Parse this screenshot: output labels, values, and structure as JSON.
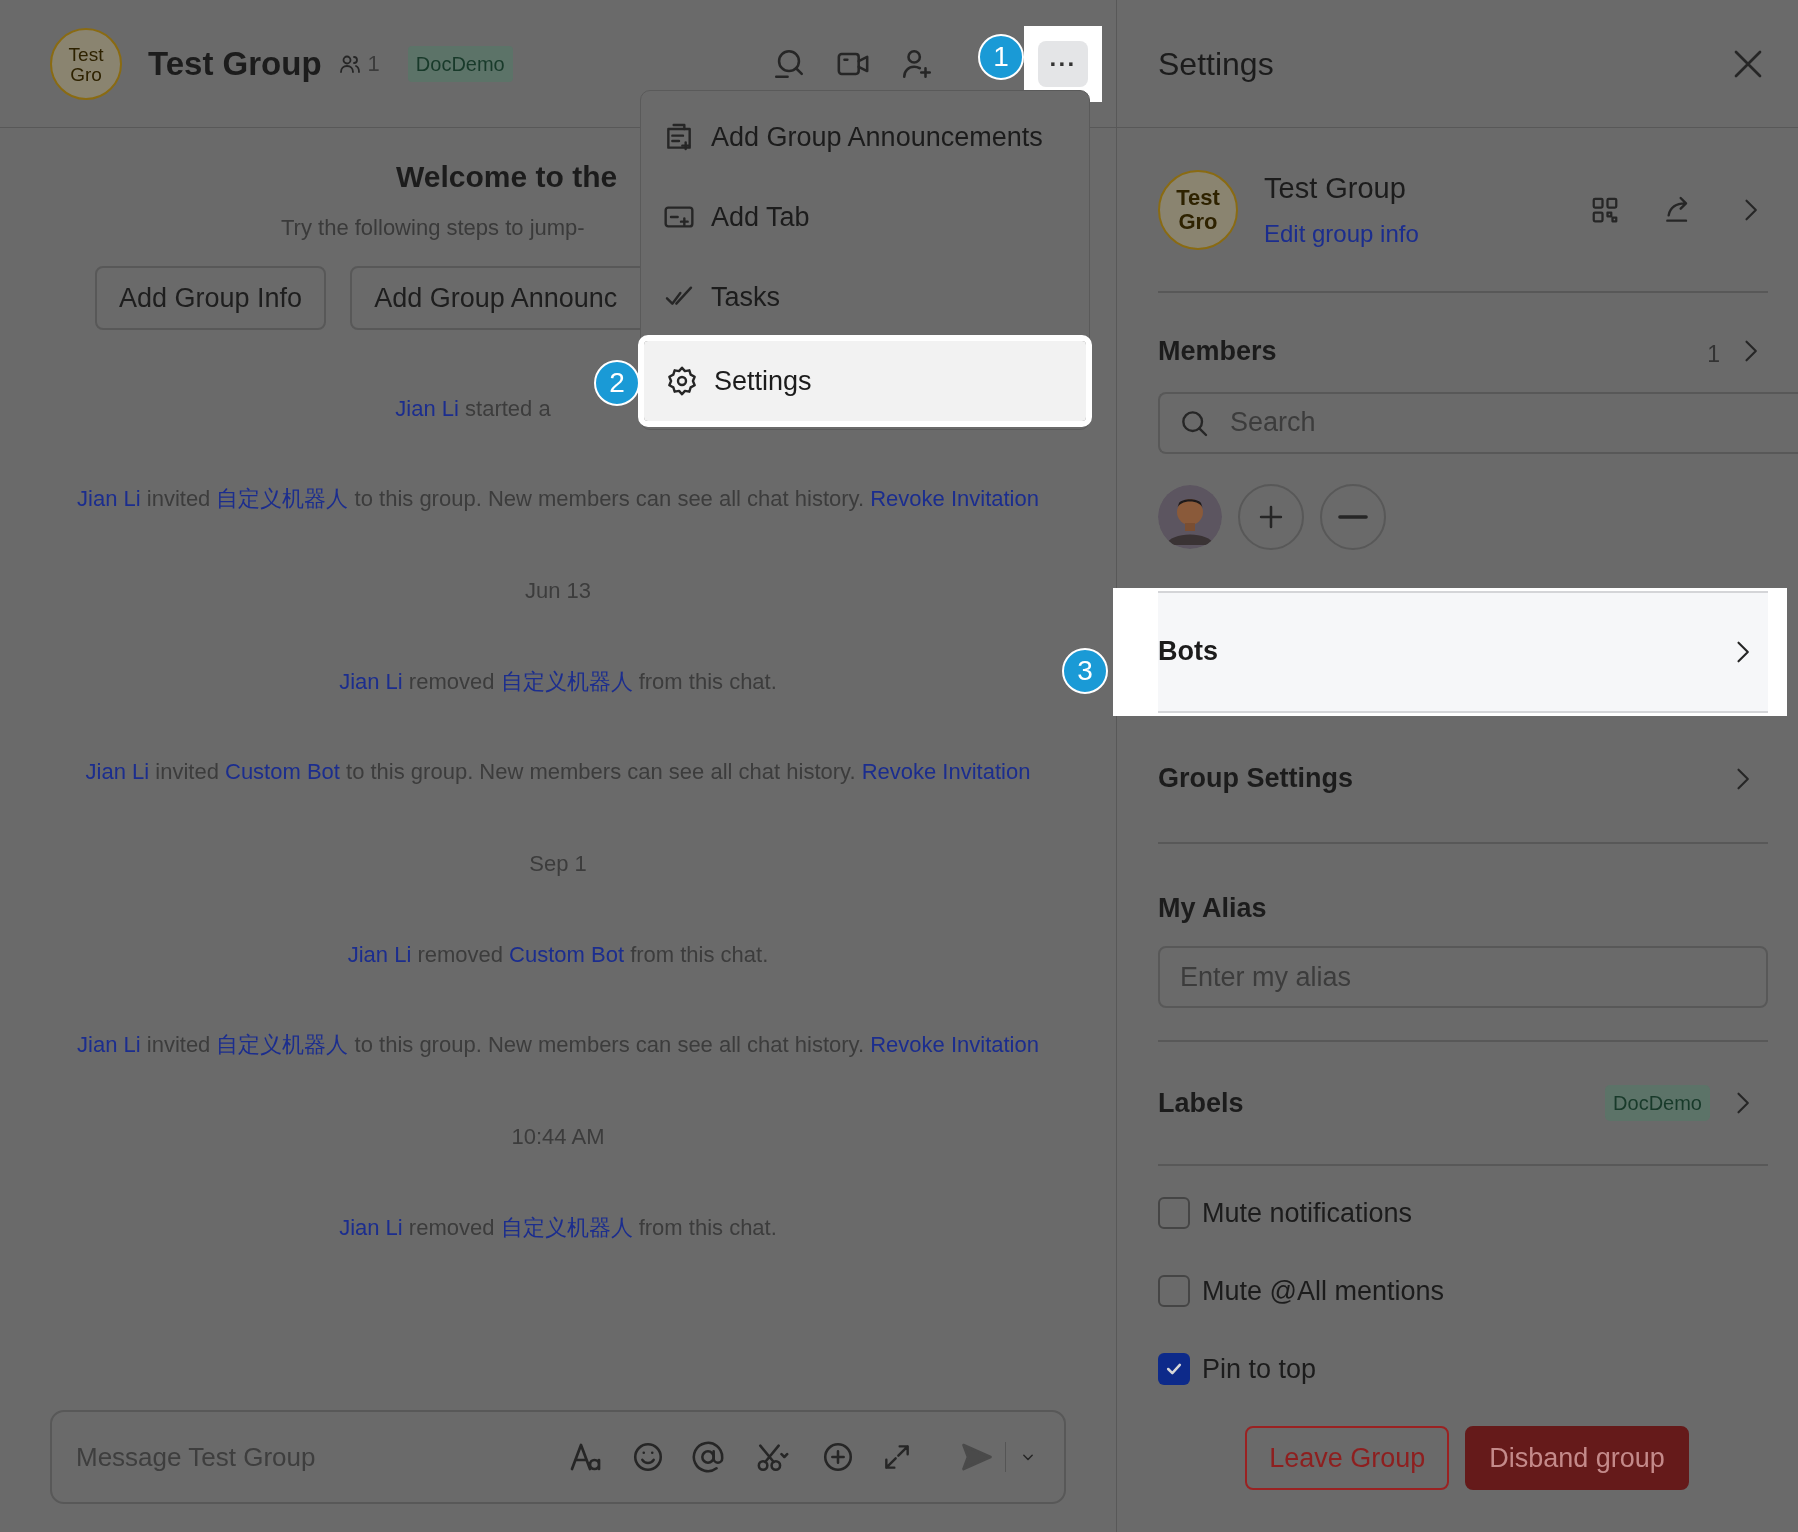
{
  "chat_header": {
    "avatar": "Test Gro",
    "title": "Test Group",
    "member_count": "1",
    "tag": "DocDemo",
    "more_button": {
      "label": "···",
      "highlighted": true
    }
  },
  "more_menu": {
    "items": [
      {
        "label": "Add Group Announcements",
        "kind": "announcement",
        "highlighted": false
      },
      {
        "label": "Add Tab",
        "kind": "tab",
        "highlighted": false
      },
      {
        "label": "Tasks",
        "kind": "tasks",
        "highlighted": false
      },
      {
        "label": "Settings",
        "kind": "settings",
        "highlighted": true
      }
    ]
  },
  "step_markers": [
    {
      "label": "1"
    },
    {
      "label": "2"
    },
    {
      "label": "3"
    }
  ],
  "welcome": {
    "title": "Welcome to the",
    "subtitle": "Try the following steps to jump-",
    "buttons": [
      "Add Group Info",
      "Add Group Announc"
    ]
  },
  "feed": [
    {
      "kind": "event",
      "parts": [
        {
          "kind": "name",
          "text": "Jian Li"
        },
        {
          "kind": "text",
          "text": " started a"
        }
      ]
    },
    {
      "kind": "event",
      "parts": [
        {
          "kind": "name",
          "text": "Jian Li"
        },
        {
          "kind": "text",
          "text": " invited "
        },
        {
          "kind": "name",
          "text": "自定义机器人"
        },
        {
          "kind": "text",
          "text": " to this group. New members can see all chat history. "
        },
        {
          "kind": "action",
          "text": "Revoke Invitation"
        }
      ]
    },
    {
      "kind": "date",
      "text": "Jun 13"
    },
    {
      "kind": "event",
      "parts": [
        {
          "kind": "name",
          "text": "Jian Li"
        },
        {
          "kind": "text",
          "text": " removed "
        },
        {
          "kind": "name",
          "text": "自定义机器人"
        },
        {
          "kind": "text",
          "text": " from this chat."
        }
      ]
    },
    {
      "kind": "event",
      "parts": [
        {
          "kind": "name",
          "text": "Jian Li"
        },
        {
          "kind": "text",
          "text": " invited "
        },
        {
          "kind": "name",
          "text": "Custom Bot"
        },
        {
          "kind": "text",
          "text": " to this group. New members can see all chat history. "
        },
        {
          "kind": "action",
          "text": "Revoke Invitation"
        }
      ]
    },
    {
      "kind": "date",
      "text": "Sep 1"
    },
    {
      "kind": "event",
      "parts": [
        {
          "kind": "name",
          "text": "Jian Li"
        },
        {
          "kind": "text",
          "text": " removed "
        },
        {
          "kind": "name",
          "text": "Custom Bot"
        },
        {
          "kind": "text",
          "text": " from this chat."
        }
      ]
    },
    {
      "kind": "event",
      "parts": [
        {
          "kind": "name",
          "text": "Jian Li"
        },
        {
          "kind": "text",
          "text": " invited "
        },
        {
          "kind": "name",
          "text": "自定义机器人"
        },
        {
          "kind": "text",
          "text": " to this group. New members can see all chat history. "
        },
        {
          "kind": "action",
          "text": "Revoke Invitation"
        }
      ]
    },
    {
      "kind": "date",
      "text": "10:44 AM"
    },
    {
      "kind": "event",
      "parts": [
        {
          "kind": "name",
          "text": "Jian Li"
        },
        {
          "kind": "text",
          "text": " removed "
        },
        {
          "kind": "name",
          "text": "自定义机器人"
        },
        {
          "kind": "text",
          "text": " from this chat."
        }
      ]
    }
  ],
  "composer": {
    "placeholder": "Message Test Group"
  },
  "settings_panel": {
    "title": "Settings",
    "group": {
      "avatar": "Test Gro",
      "name": "Test Group",
      "edit_link": "Edit group info"
    },
    "members": {
      "title": "Members",
      "count": "1",
      "search_placeholder": "Search"
    },
    "rows": [
      {
        "label": "Bots",
        "highlighted": true
      },
      {
        "label": "Group Settings",
        "highlighted": false
      }
    ],
    "alias": {
      "title": "My Alias",
      "placeholder": "Enter my alias"
    },
    "labels": {
      "title": "Labels",
      "tag": "DocDemo"
    },
    "options": [
      {
        "label": "Mute notifications",
        "checked": false
      },
      {
        "label": "Mute @All mentions",
        "checked": false
      },
      {
        "label": "Pin to top",
        "checked": true
      }
    ],
    "buttons": [
      {
        "label": "Leave Group",
        "kind": "outline"
      },
      {
        "label": "Disband group",
        "kind": "danger"
      }
    ]
  }
}
